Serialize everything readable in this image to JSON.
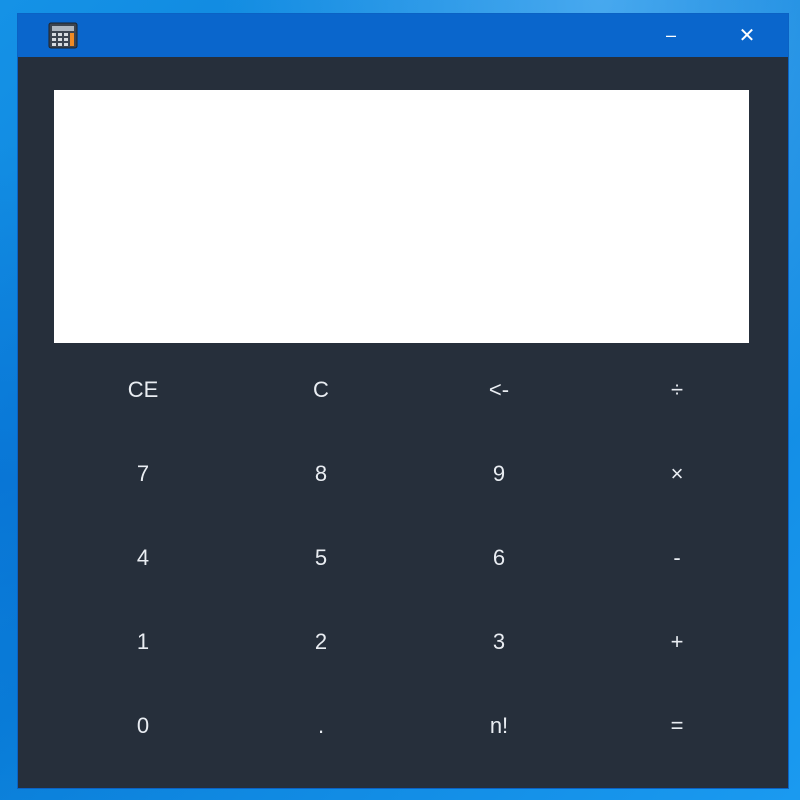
{
  "window": {
    "icon": "calculator-icon",
    "minimize_icon": "minimize-icon",
    "close_icon": "close-icon",
    "minimize_glyph": "–",
    "close_glyph": "✕"
  },
  "display": {
    "value": ""
  },
  "keypad": {
    "rows": [
      [
        "CE",
        "C",
        "<-",
        "÷"
      ],
      [
        "7",
        "8",
        "9",
        "×"
      ],
      [
        "4",
        "5",
        "6",
        "-"
      ],
      [
        "1",
        "2",
        "3",
        "+"
      ],
      [
        "0",
        ".",
        "n!",
        "="
      ]
    ]
  },
  "colors": {
    "titlebar": "#0a66cc",
    "window_background": "#262f3b",
    "display_background": "#ffffff",
    "key_text": "#e9edf2"
  }
}
